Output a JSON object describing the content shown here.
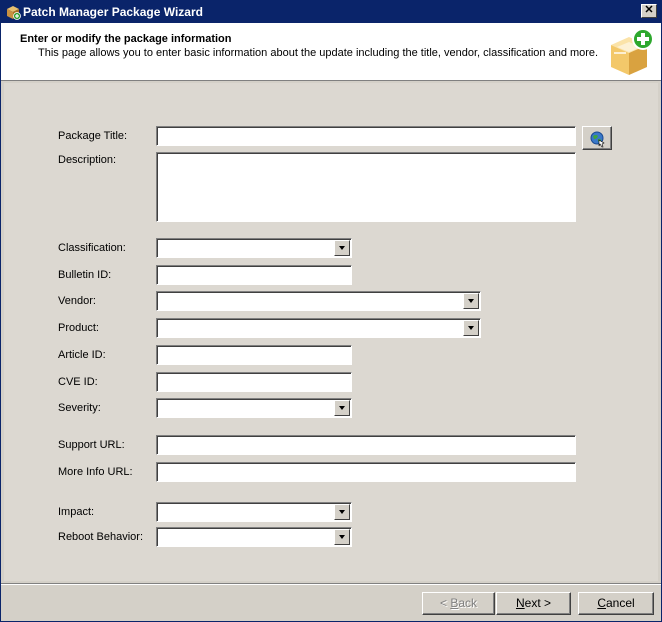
{
  "window": {
    "title": "Patch Manager Package Wizard",
    "close_glyph": "✕"
  },
  "header": {
    "title": "Enter or modify the package information",
    "description": "This page allows you to enter basic information about the update including the title, vendor, classification and more.",
    "icon": "package-add-icon"
  },
  "form": {
    "package_title": {
      "label": "Package Title:",
      "value": ""
    },
    "description": {
      "label": "Description:",
      "value": ""
    },
    "classification": {
      "label": "Classification:",
      "value": ""
    },
    "bulletin_id": {
      "label": "Bulletin ID:",
      "value": ""
    },
    "vendor": {
      "label": "Vendor:",
      "value": ""
    },
    "product": {
      "label": "Product:",
      "value": ""
    },
    "article_id": {
      "label": "Article ID:",
      "value": ""
    },
    "cve_id": {
      "label": "CVE ID:",
      "value": ""
    },
    "severity": {
      "label": "Severity:",
      "value": ""
    },
    "support_url": {
      "label": "Support URL:",
      "value": ""
    },
    "more_info_url": {
      "label": "More Info URL:",
      "value": ""
    },
    "impact": {
      "label": "Impact:",
      "value": ""
    },
    "reboot_behavior": {
      "label": "Reboot Behavior:",
      "value": ""
    },
    "browse_icon": "globe-search-icon"
  },
  "footer": {
    "back": {
      "prefix": "< ",
      "accel": "B",
      "rest": "ack"
    },
    "next": {
      "accel": "N",
      "rest": "ext >"
    },
    "cancel": {
      "accel": "C",
      "rest": "ancel"
    }
  },
  "colors": {
    "titlebar": "#0a246a",
    "dialog": "#d4d0c8",
    "header_bg": "#ffffff"
  }
}
